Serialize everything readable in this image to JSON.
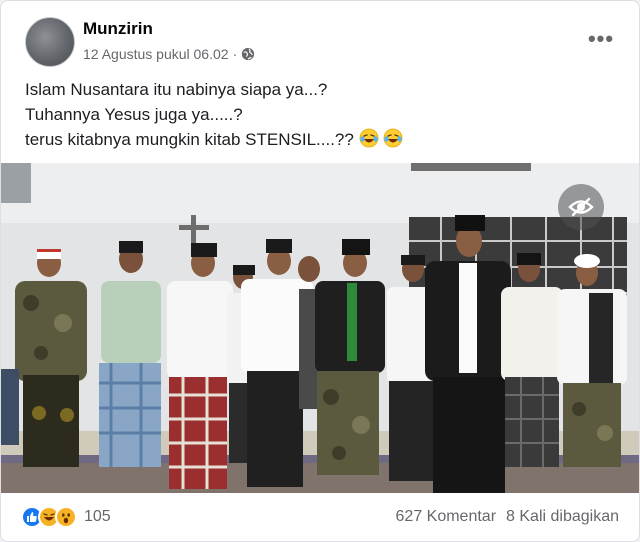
{
  "post": {
    "author": "Munzirin",
    "timestamp": "12 Agustus pukul 06.02",
    "separator": "·",
    "privacy_icon": "globe-icon",
    "more_icon": "more-icon",
    "more_label": "•••",
    "lines": [
      "Islam Nusantara itu nabinya siapa ya...?",
      "Tuhannya Yesus juga ya.....?",
      "terus kitabnya mungkin kitab STENSIL....??"
    ],
    "line3_emojis": [
      "laughing-crying-emoji",
      "laughing-crying-emoji"
    ]
  },
  "photo": {
    "overlay_icon": "eye-slash-icon"
  },
  "footer": {
    "reaction_icons": [
      "like-icon",
      "haha-icon",
      "wow-icon"
    ],
    "reaction_count": "105",
    "comments": "627 Komentar",
    "shares": "8 Kali dibagikan"
  },
  "colors": {
    "secondary_text": "#65676b",
    "like_blue": "#1877f2",
    "reaction_yellow": "#f7b125"
  }
}
